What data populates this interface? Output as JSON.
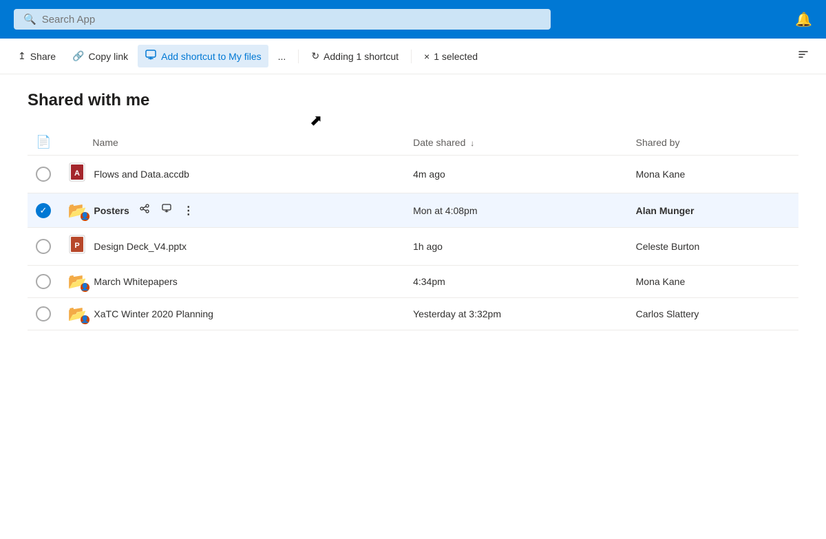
{
  "header": {
    "search_placeholder": "Search App",
    "bell_icon": "🔔"
  },
  "toolbar": {
    "share_label": "Share",
    "copy_link_label": "Copy link",
    "add_shortcut_label": "Add shortcut to My files",
    "more_label": "...",
    "adding_shortcut_label": "Adding 1 shortcut",
    "selected_label": "1 selected",
    "sort_icon": "↕"
  },
  "page": {
    "title": "Shared with me"
  },
  "table": {
    "columns": {
      "name": "Name",
      "date_shared": "Date shared",
      "shared_by": "Shared by"
    },
    "rows": [
      {
        "id": "row-1",
        "icon_type": "access",
        "icon": "🗋",
        "name": "Flows and Data.accdb",
        "date_shared": "4m ago",
        "shared_by": "Mona Kane",
        "selected": false,
        "bold": false
      },
      {
        "id": "row-2",
        "icon_type": "folder-shared",
        "icon": "📁",
        "name": "Posters",
        "date_shared": "Mon at 4:08pm",
        "shared_by": "Alan Munger",
        "selected": true,
        "bold": true
      },
      {
        "id": "row-3",
        "icon_type": "powerpoint",
        "icon": "🗋",
        "name": "Design Deck_V4.pptx",
        "date_shared": "1h ago",
        "shared_by": "Celeste Burton",
        "selected": false,
        "bold": false
      },
      {
        "id": "row-4",
        "icon_type": "folder-shared",
        "icon": "📁",
        "name": "March Whitepapers",
        "date_shared": "4:34pm",
        "shared_by": "Mona Kane",
        "selected": false,
        "bold": false
      },
      {
        "id": "row-5",
        "icon_type": "folder-shared",
        "icon": "📁",
        "name": "XaTC Winter 2020 Planning",
        "date_shared": "Yesterday at 3:32pm",
        "shared_by": "Carlos Slattery",
        "selected": false,
        "bold": false
      }
    ]
  }
}
